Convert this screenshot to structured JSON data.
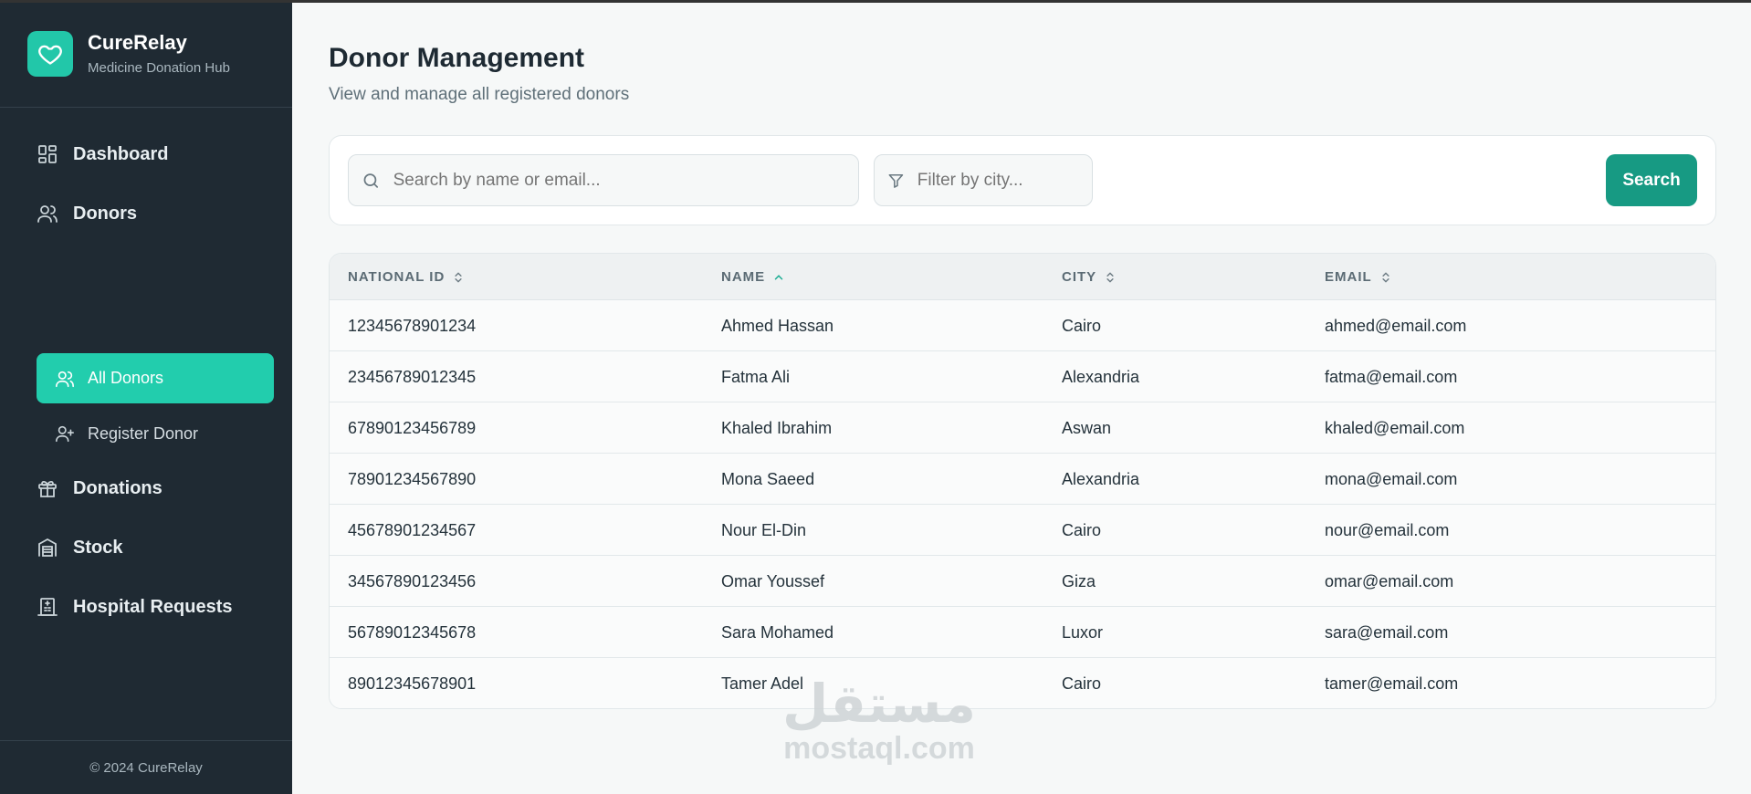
{
  "brand": {
    "name": "CureRelay",
    "tagline": "Medicine Donation Hub",
    "icon": "heart-icon",
    "accent": "#22c7a9"
  },
  "sidebar": {
    "items": [
      {
        "label": "Dashboard",
        "icon": "dashboard-icon"
      },
      {
        "label": "Donors",
        "icon": "users-icon"
      },
      {
        "label": "Donations",
        "icon": "gift-icon"
      },
      {
        "label": "Stock",
        "icon": "warehouse-icon"
      },
      {
        "label": "Hospital Requests",
        "icon": "hospital-icon"
      }
    ],
    "donor_sub": [
      {
        "label": "All Donors",
        "icon": "users-icon",
        "active": true
      },
      {
        "label": "Register Donor",
        "icon": "user-plus-icon",
        "active": false
      }
    ],
    "footer": "© 2024 CureRelay"
  },
  "page": {
    "title": "Donor Management",
    "subtitle": "View and manage all registered donors"
  },
  "filters": {
    "search_placeholder": "Search by name or email...",
    "city_placeholder": "Filter by city...",
    "search_button": "Search",
    "button_color": "#179a83"
  },
  "table": {
    "columns": [
      {
        "label": "NATIONAL ID",
        "sort": "none"
      },
      {
        "label": "NAME",
        "sort": "asc"
      },
      {
        "label": "CITY",
        "sort": "none"
      },
      {
        "label": "EMAIL",
        "sort": "none"
      }
    ],
    "rows": [
      [
        "12345678901234",
        "Ahmed Hassan",
        "Cairo",
        "ahmed@email.com"
      ],
      [
        "23456789012345",
        "Fatma Ali",
        "Alexandria",
        "fatma@email.com"
      ],
      [
        "67890123456789",
        "Khaled Ibrahim",
        "Aswan",
        "khaled@email.com"
      ],
      [
        "78901234567890",
        "Mona Saeed",
        "Alexandria",
        "mona@email.com"
      ],
      [
        "45678901234567",
        "Nour El-Din",
        "Cairo",
        "nour@email.com"
      ],
      [
        "34567890123456",
        "Omar Youssef",
        "Giza",
        "omar@email.com"
      ],
      [
        "56789012345678",
        "Sara Mohamed",
        "Luxor",
        "sara@email.com"
      ],
      [
        "89012345678901",
        "Tamer Adel",
        "Cairo",
        "tamer@email.com"
      ]
    ]
  },
  "watermark": {
    "arabic": "مستقل",
    "latin": "mostaql.com"
  }
}
